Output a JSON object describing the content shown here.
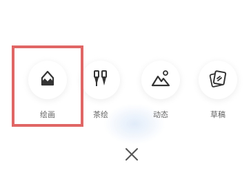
{
  "menu": {
    "items": [
      {
        "label": "绘画",
        "icon": "pencil-icon"
      },
      {
        "label": "茶绘",
        "icon": "brushes-icon"
      },
      {
        "label": "动态",
        "icon": "mountain-sun-icon"
      },
      {
        "label": "草稿",
        "icon": "draft-cards-icon"
      }
    ],
    "selected_index": 0,
    "highlight_color": "#e06666",
    "close_icon": "close-icon"
  }
}
